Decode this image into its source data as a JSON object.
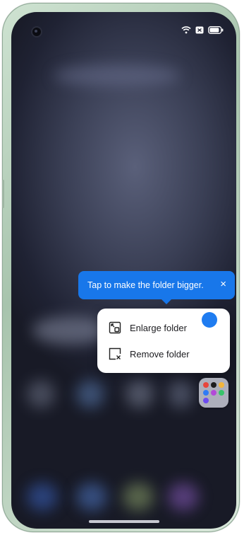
{
  "tooltip": {
    "text": "Tap to make the folder bigger.",
    "close_glyph": "×",
    "color": "#1877ea"
  },
  "menu": {
    "items": [
      {
        "label": "Enlarge folder",
        "icon": "enlarge-folder-icon"
      },
      {
        "label": "Remove folder",
        "icon": "remove-folder-icon"
      }
    ]
  },
  "status_bar": {
    "icons": [
      "wifi-icon",
      "sim-icon",
      "battery-icon"
    ]
  },
  "folder": {
    "icon": "app-folder-icon",
    "app_colors": [
      "#e8453c",
      "#1d1d1d",
      "#f2b53b",
      "#2f7bf5",
      "#b34ad8",
      "#37c46a",
      "#6c4bf0"
    ]
  },
  "touch_indicator_color": "#1f7cf0"
}
